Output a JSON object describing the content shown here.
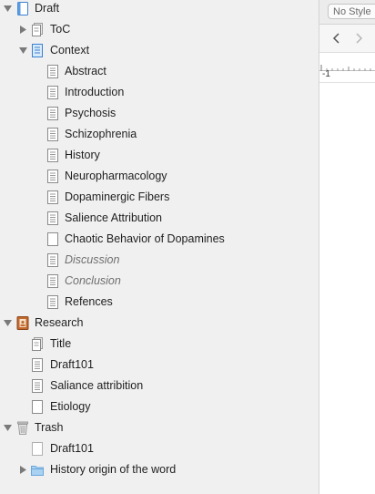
{
  "binder": {
    "items": [
      {
        "label": "Draft"
      },
      {
        "label": "ToC"
      },
      {
        "label": "Context"
      },
      {
        "label": "Abstract"
      },
      {
        "label": "Introduction"
      },
      {
        "label": "Psychosis"
      },
      {
        "label": "Schizophrenia"
      },
      {
        "label": "History"
      },
      {
        "label": "Neuropharmacology"
      },
      {
        "label": "Dopaminergic Fibers"
      },
      {
        "label": "Salience Attribution"
      },
      {
        "label": "Chaotic Behavior of Dopamines"
      },
      {
        "label": "Discussion"
      },
      {
        "label": "Conclusion"
      },
      {
        "label": "Refences"
      },
      {
        "label": "Research"
      },
      {
        "label": "Title"
      },
      {
        "label": "Draft101"
      },
      {
        "label": "Saliance attribition"
      },
      {
        "label": "Etiology"
      },
      {
        "label": "Trash"
      },
      {
        "label": "Draft101"
      },
      {
        "label": "History origin of the word"
      }
    ]
  },
  "editor": {
    "style_select": "No Style",
    "ruler_marker": "-1"
  },
  "colors": {
    "sidebar_bg": "#f0f0f0",
    "folder_blue": "#7fb6e6",
    "research_orange": "#c46a2e"
  }
}
